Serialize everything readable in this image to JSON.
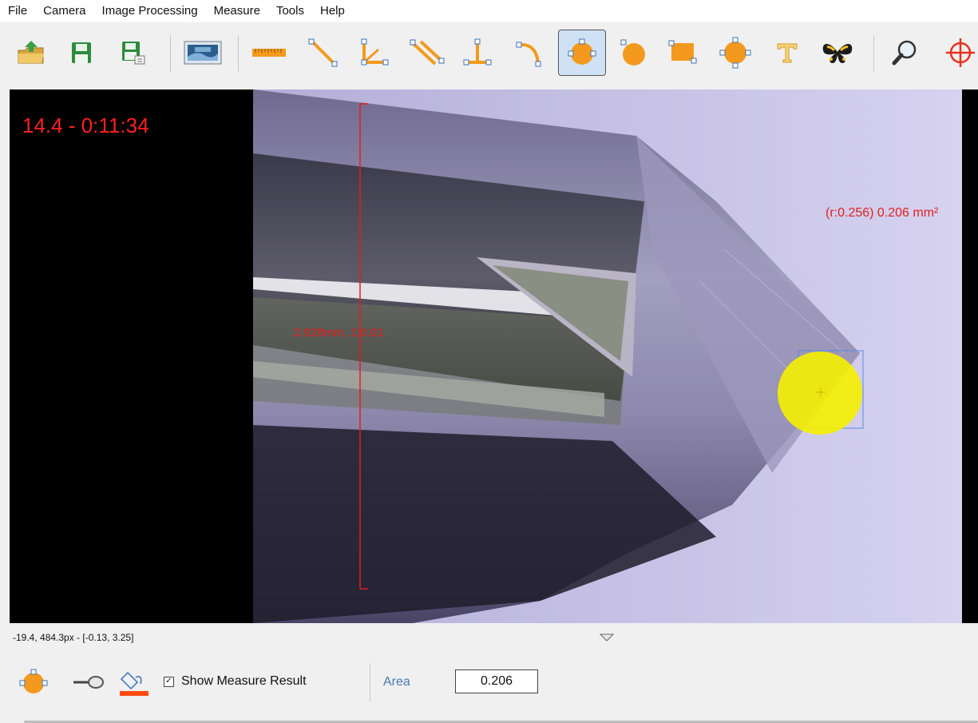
{
  "menu": [
    "File",
    "Camera",
    "Image Processing",
    "Measure",
    "Tools",
    "Help"
  ],
  "toolbar": {
    "items": [
      {
        "name": "open-icon"
      },
      {
        "name": "save-icon"
      },
      {
        "name": "save-as-icon"
      },
      {
        "name": "snapshot-icon"
      },
      {
        "name": "ruler-icon"
      },
      {
        "name": "line-icon"
      },
      {
        "name": "angle-icon"
      },
      {
        "name": "parallel-lines-icon"
      },
      {
        "name": "perpendicular-icon"
      },
      {
        "name": "arc-icon"
      },
      {
        "name": "circle-center-icon",
        "active": true
      },
      {
        "name": "circle-three-point-icon"
      },
      {
        "name": "rectangle-icon"
      },
      {
        "name": "polygon-icon"
      },
      {
        "name": "text-icon"
      },
      {
        "name": "butterfly-icon"
      },
      {
        "name": "zoom-icon"
      },
      {
        "name": "crosshair-icon"
      }
    ]
  },
  "viewport": {
    "timestamp": "14.4 - 0:11:34",
    "circle_measure": "(r:0.256) 0.206 mm²",
    "line_measure": "2.928mm, 1:0.01"
  },
  "status": {
    "coords": "-19.4, 484.3px - [-0.13, 3.25]"
  },
  "bottom_panel": {
    "show_result_label": "Show Measure Result",
    "show_result_checked": true,
    "area_label": "Area",
    "area_value": "0.206"
  },
  "colors": {
    "measure_red": "#e02020",
    "selection_yellow": "#f5f000",
    "accent_orange": "#f39a1e",
    "label_blue": "#4a78b8"
  }
}
